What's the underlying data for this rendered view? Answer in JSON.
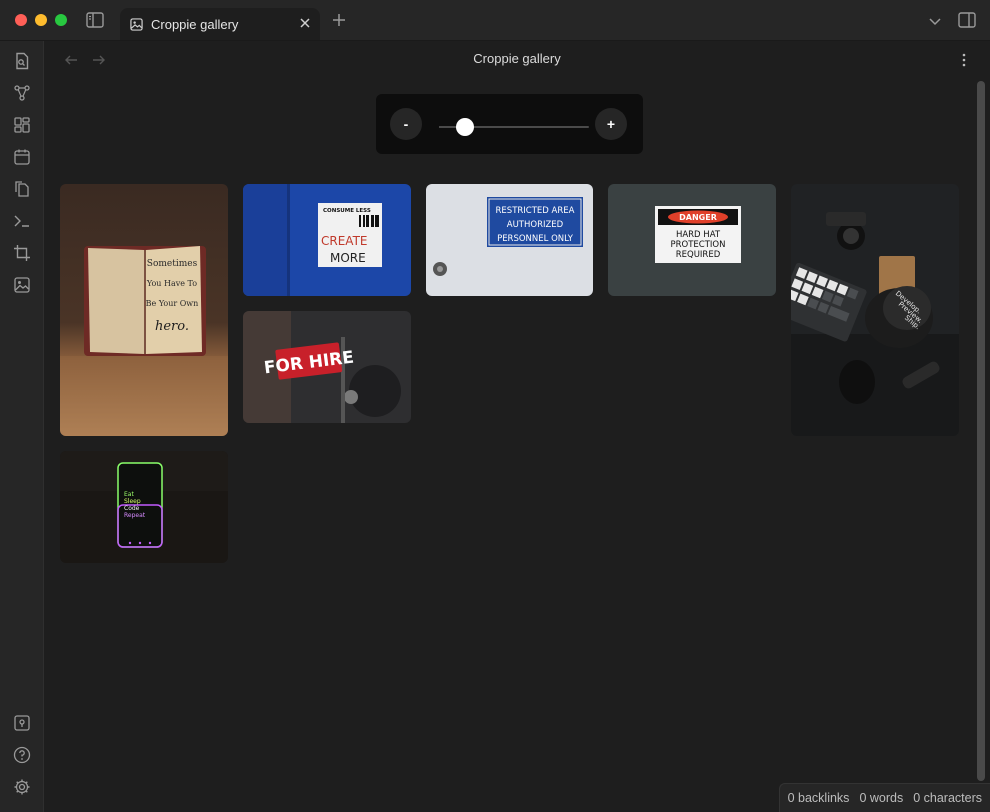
{
  "window": {
    "tab_title": "Croppie gallery"
  },
  "header": {
    "title": "Croppie gallery"
  },
  "zoom": {
    "minus_label": "-",
    "plus_label": "+",
    "level": 0.17
  },
  "gallery": {
    "images": [
      {
        "name": "notebook",
        "text": "Sometimes You Have To Be Your Own hero."
      },
      {
        "name": "consume-less-sticker",
        "top": "CONSUME LESS",
        "line1": "CREATE",
        "line2": "MORE"
      },
      {
        "name": "restricted-area-sign",
        "line1": "RESTRICTED AREA",
        "line2": "AUTHORIZED",
        "line3": "PERSONNEL ONLY"
      },
      {
        "name": "danger-sign",
        "header": "DANGER",
        "line1": "HARD HAT",
        "line2": "PROTECTION",
        "line3": "REQUIRED"
      },
      {
        "name": "desk-keyboard-mug",
        "mug_text": "Develop. Preview. Ship."
      },
      {
        "name": "for-hire-sign",
        "text": "FOR HIRE"
      },
      {
        "name": "phone-neon",
        "line1": "Eat",
        "line2": "Sleep",
        "line3": "Code",
        "line4": "Repeat"
      }
    ]
  },
  "status": {
    "backlinks": "0 backlinks",
    "words": "0 words",
    "characters": "0 characters"
  }
}
